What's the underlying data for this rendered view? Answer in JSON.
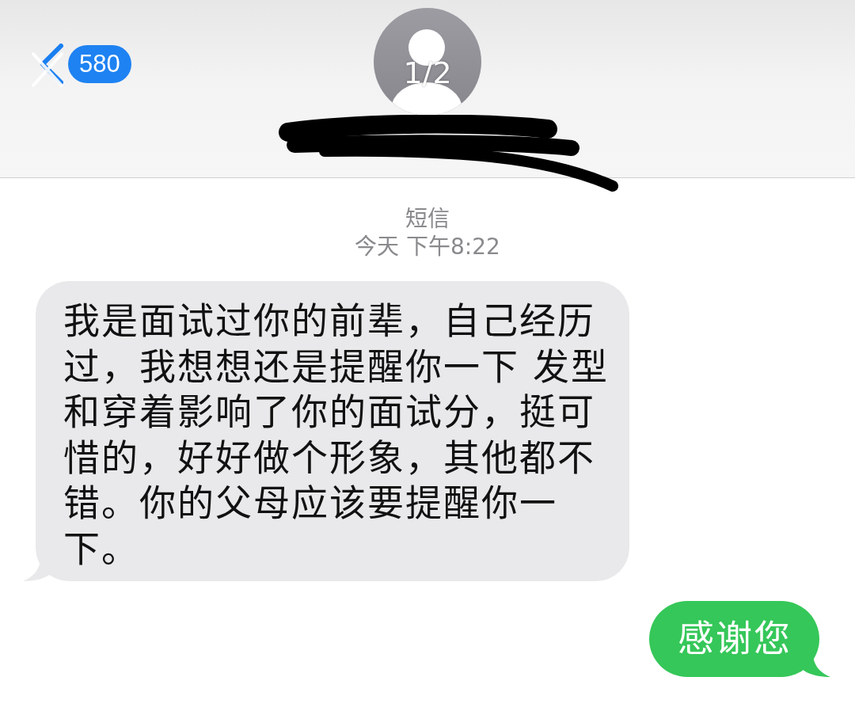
{
  "viewer_overlay": {
    "page_counter": "1/2"
  },
  "header": {
    "back_button": {
      "badge": "580"
    }
  },
  "conversation": {
    "service_label": "短信",
    "timestamp": "今天 下午8:22",
    "messages": [
      {
        "kind": "received",
        "text": "我是面试过你的前辈，自己经历过，我想想还是提醒你一下 发型和穿着影响了你的面试分，挺可惜的，好好做个形象，其他都不错。你的父母应该要提醒你一下。"
      },
      {
        "kind": "sent",
        "text": "感谢您"
      }
    ]
  }
}
